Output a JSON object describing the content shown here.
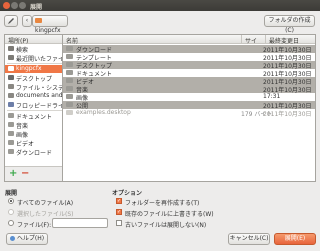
{
  "window": {
    "title": "展開"
  },
  "toolbar": {
    "path_button": "kingpcfx",
    "create_folder": "フォルダの作成(C)"
  },
  "places": {
    "header": "場所(P)",
    "items": [
      {
        "label": "検索",
        "icon": "search-icon",
        "selected": false
      },
      {
        "label": "最近開いたファイル",
        "icon": "clock-icon",
        "selected": false
      },
      {
        "label": "kingpcfx",
        "icon": "home-folder-icon",
        "selected": true
      },
      {
        "label": "デスクトップ",
        "icon": "desktop-icon",
        "selected": false
      },
      {
        "label": "ファイル・システム",
        "icon": "harddisk-icon",
        "selected": false
      },
      {
        "label": "documents and...",
        "icon": "drive-icon",
        "selected": false
      },
      {
        "label": "フロッピードライブ",
        "icon": "floppy-icon",
        "selected": false
      },
      {
        "label": "ドキュメント",
        "icon": "folder-icon",
        "selected": false
      },
      {
        "label": "音楽",
        "icon": "folder-icon",
        "selected": false
      },
      {
        "label": "画像",
        "icon": "folder-icon",
        "selected": false
      },
      {
        "label": "ビデオ",
        "icon": "folder-icon",
        "selected": false
      },
      {
        "label": "ダウンロード",
        "icon": "folder-icon",
        "selected": false
      }
    ],
    "add_symbol": "+",
    "remove_symbol": "−"
  },
  "files": {
    "columns": {
      "name": "名前",
      "size": "サイズ",
      "modified": "最終変更日"
    },
    "rows": [
      {
        "name": "ダウンロード",
        "size": "",
        "modified": "2011年10月30日",
        "style": "gray"
      },
      {
        "name": "テンプレート",
        "size": "",
        "modified": "2011年10月30日",
        "style": ""
      },
      {
        "name": "デスクトップ",
        "size": "",
        "modified": "2011年10月30日",
        "style": "gray"
      },
      {
        "name": "ドキュメント",
        "size": "",
        "modified": "2011年10月30日",
        "style": ""
      },
      {
        "name": "ビデオ",
        "size": "",
        "modified": "2011年10月30日",
        "style": "gray"
      },
      {
        "name": "音楽",
        "size": "",
        "modified": "2011年10月30日",
        "style": "gray"
      },
      {
        "name": "画像",
        "size": "",
        "modified": "17:31",
        "style": ""
      },
      {
        "name": "公開",
        "size": "",
        "modified": "2011年10月30日",
        "style": "gray"
      },
      {
        "name": "examples.desktop",
        "size": "179 バイト",
        "modified": "2011年10月30日",
        "style": "dim"
      }
    ]
  },
  "extract": {
    "header": "展開",
    "all_files": "すべてのファイル(A)",
    "selected_files": "選択したファイル(S)",
    "files_label": "ファイル(F):",
    "files_value": ""
  },
  "options": {
    "header": "オプション",
    "recreate_folders": "フォルダーを再作成する(T)",
    "overwrite": "既存のファイルに上書きする(W)",
    "no_older": "古いファイルは展開しない(N)"
  },
  "buttons": {
    "help": "ヘルプ(H)",
    "cancel": "キャンセル(C)",
    "extract": "展開(E)"
  },
  "colors": {
    "accent": "#f07746",
    "selection_gray": "#b2afa9"
  }
}
